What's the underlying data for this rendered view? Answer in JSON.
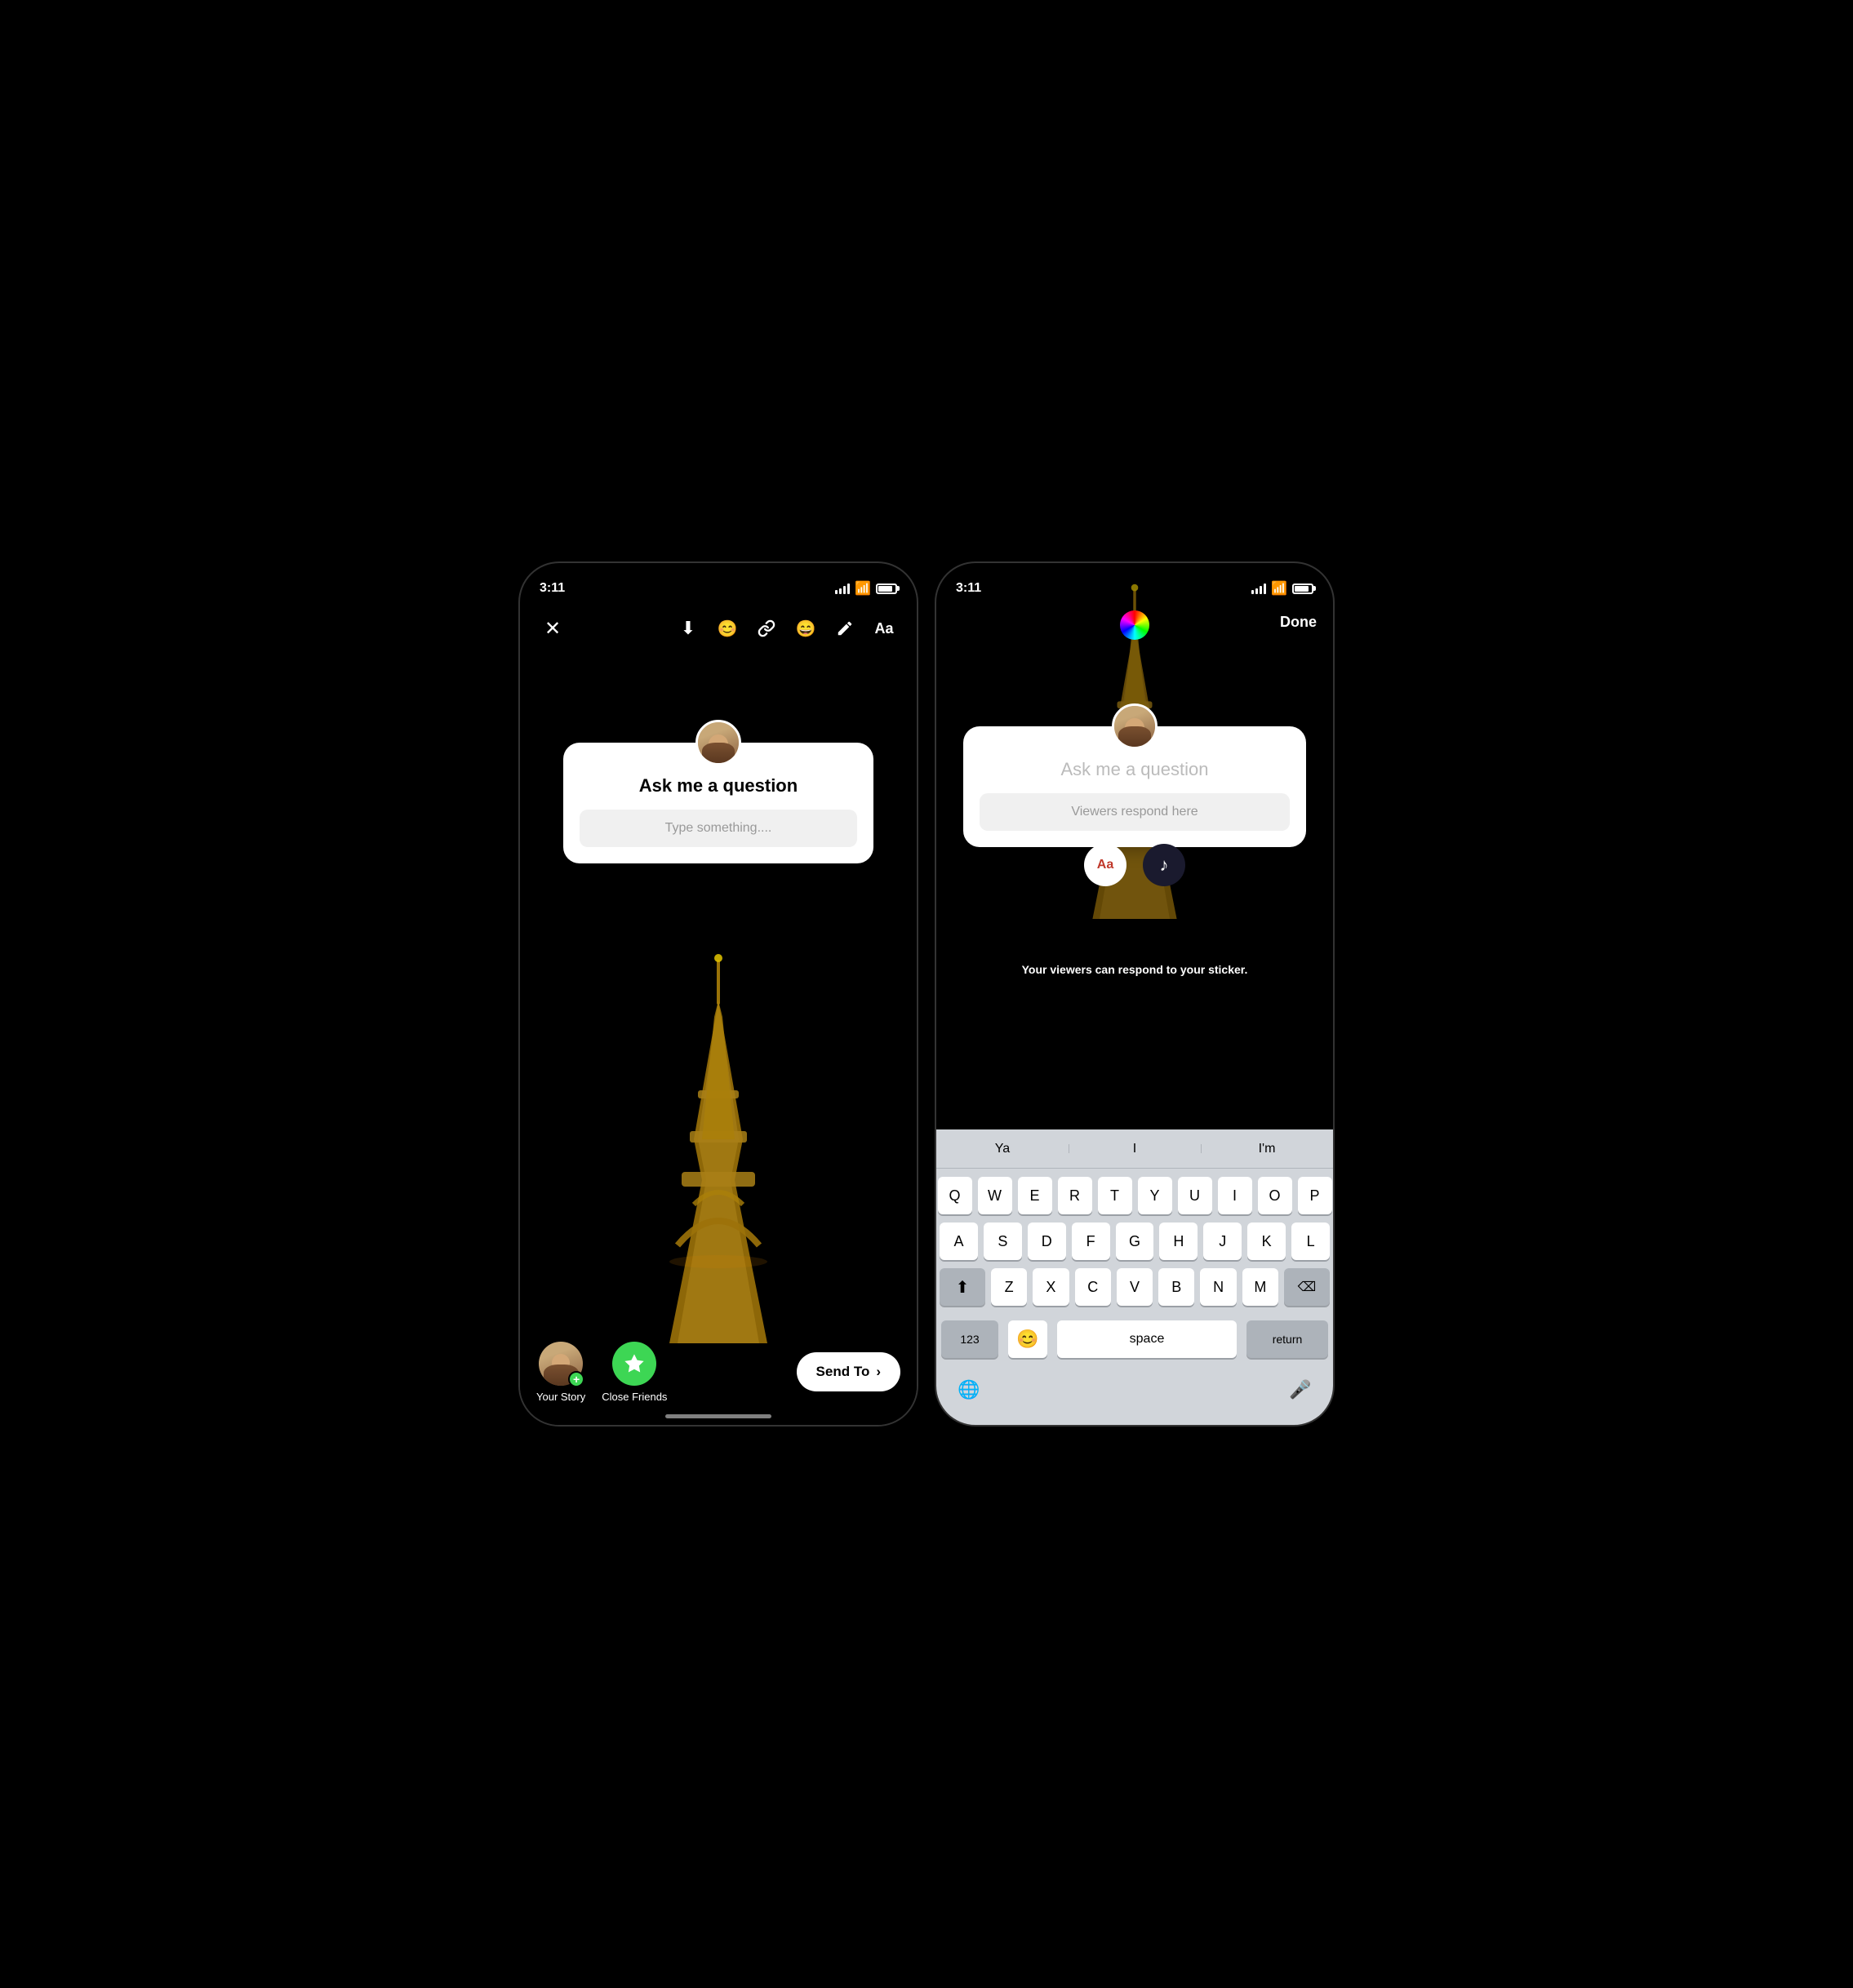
{
  "left_phone": {
    "status_time": "3:11",
    "toolbar": {
      "close_label": "✕",
      "download_label": "⬇",
      "effects_label": "😊",
      "link_label": "🔗",
      "sticker_label": "😄",
      "draw_label": "✏",
      "text_label": "Aa"
    },
    "sticker": {
      "title": "Ask me a question",
      "placeholder": "Type something...."
    },
    "bottom": {
      "your_story_label": "Your Story",
      "close_friends_label": "Close Friends",
      "send_to_label": "Send To",
      "send_to_arrow": "›"
    }
  },
  "right_phone": {
    "status_time": "3:11",
    "done_label": "Done",
    "sticker": {
      "title": "Ask me a question",
      "placeholder": "Viewers respond here"
    },
    "viewers_note": "Your viewers can respond to your sticker.",
    "tools": {
      "text_label": "Aa",
      "music_label": "♪"
    },
    "autocomplete": [
      "Ya",
      "I",
      "I'm"
    ],
    "keyboard_rows": [
      [
        "Q",
        "W",
        "E",
        "R",
        "T",
        "Y",
        "U",
        "I",
        "O",
        "P"
      ],
      [
        "A",
        "S",
        "D",
        "F",
        "G",
        "H",
        "J",
        "K",
        "L"
      ],
      [
        "Z",
        "X",
        "C",
        "V",
        "B",
        "N",
        "M"
      ]
    ],
    "special_keys": {
      "shift": "⬆",
      "backspace": "⌫",
      "numbers": "123",
      "emoji": "😊",
      "space": "space",
      "return": "return",
      "globe": "🌐",
      "mic": "🎤"
    }
  }
}
